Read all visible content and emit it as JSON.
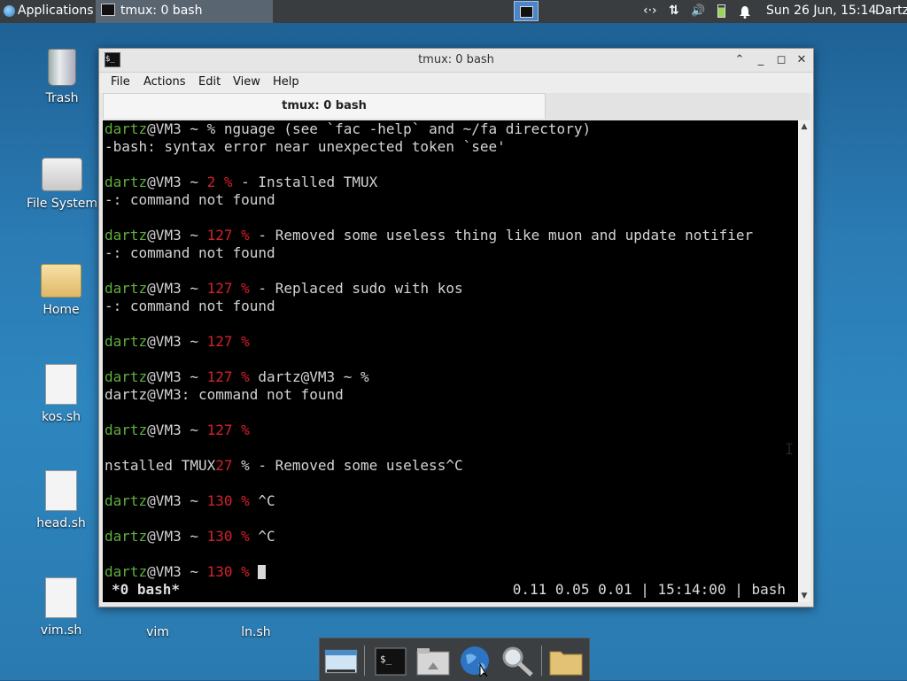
{
  "top_panel": {
    "applications_label": "Applications",
    "task_title": "tmux: 0 bash",
    "tray_network": "‹·›",
    "tray_transfer": "⇅",
    "tray_volume": "🔊",
    "clock": "Sun 26 Jun, 15:14",
    "user": "Dartz"
  },
  "desktop_icons": [
    {
      "label": "Trash"
    },
    {
      "label": "File System"
    },
    {
      "label": "Home"
    },
    {
      "label": "kos.sh"
    },
    {
      "label": "head.sh"
    },
    {
      "label": "vim.sh"
    },
    {
      "label": "vim"
    },
    {
      "label": "ln.sh"
    }
  ],
  "window": {
    "title": "tmux: 0 bash",
    "menu": [
      "File",
      "Actions",
      "Edit",
      "View",
      "Help"
    ],
    "tab_label": "tmux: 0 bash"
  },
  "terminal": {
    "lines": [
      {
        "user": "dartz",
        "host": "@VM3 ~ ",
        "code": "",
        "pct": "% ",
        "cmd": "nguage (see `fac -help` and ~/fa directory)"
      },
      {
        "text": "-bash: syntax error near unexpected token `see'"
      },
      {
        "text": ""
      },
      {
        "user": "dartz",
        "host": "@VM3 ~ ",
        "code": "2",
        "pct": " % ",
        "cmd": "- Installed TMUX"
      },
      {
        "text": "-: command not found"
      },
      {
        "text": ""
      },
      {
        "user": "dartz",
        "host": "@VM3 ~ ",
        "code": "127",
        "pct": " % ",
        "cmd": "- Removed some useless thing like muon and update notifier"
      },
      {
        "text": "-: command not found"
      },
      {
        "text": ""
      },
      {
        "user": "dartz",
        "host": "@VM3 ~ ",
        "code": "127",
        "pct": " % ",
        "cmd": "- Replaced sudo with kos"
      },
      {
        "text": "-: command not found"
      },
      {
        "text": ""
      },
      {
        "user": "dartz",
        "host": "@VM3 ~ ",
        "code": "127",
        "pct": " %",
        "cmd": ""
      },
      {
        "text": ""
      },
      {
        "user": "dartz",
        "host": "@VM3 ~ ",
        "code": "127",
        "pct": " % ",
        "cmd": "dartz@VM3 ~ %"
      },
      {
        "text": "dartz@VM3: command not found"
      },
      {
        "text": ""
      },
      {
        "user": "dartz",
        "host": "@VM3 ~ ",
        "code": "127",
        "pct": " %",
        "cmd": ""
      },
      {
        "text": ""
      },
      {
        "mixed_a": "nstalled TMUX",
        "mixed_code": "27",
        "mixed_b": " % - Removed some useless^C"
      },
      {
        "text": ""
      },
      {
        "user": "dartz",
        "host": "@VM3 ~ ",
        "code": "130",
        "pct": " % ",
        "cmd": "^C"
      },
      {
        "text": ""
      },
      {
        "user": "dartz",
        "host": "@VM3 ~ ",
        "code": "130",
        "pct": " % ",
        "cmd": "^C"
      },
      {
        "text": ""
      },
      {
        "user": "dartz",
        "host": "@VM3 ~ ",
        "code": "130",
        "pct": " % ",
        "cmd": ""
      }
    ],
    "status_left": "*0 bash*",
    "status_right": "0.11 0.05 0.01 | 15:14:00 | bash"
  },
  "colors": {
    "prompt_user": "#5fae3f",
    "exit_code": "#d3222a",
    "terminal_bg": "#000000"
  }
}
